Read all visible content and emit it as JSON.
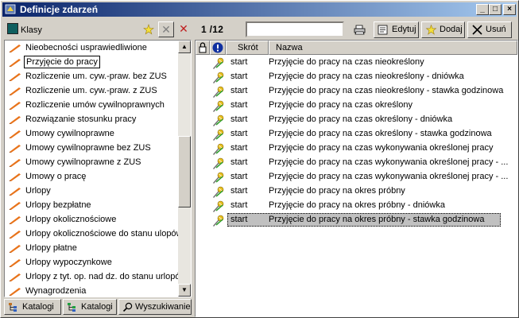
{
  "window": {
    "title": "Definicje zdarzeń"
  },
  "left_panel": {
    "header_label": "Klasy",
    "items": [
      {
        "label": "Nieobecności usprawiedliwione"
      },
      {
        "label": "Przyjęcie do pracy",
        "selected": true
      },
      {
        "label": "Rozliczenie um. cyw.-praw. bez ZUS"
      },
      {
        "label": "Rozliczenie um. cyw.-praw. z ZUS"
      },
      {
        "label": "Rozliczenie umów cywilnoprawnych"
      },
      {
        "label": "Rozwiązanie stosunku pracy"
      },
      {
        "label": "Umowy cywilnoprawne"
      },
      {
        "label": "Umowy cywilnoprawne bez ZUS"
      },
      {
        "label": "Umowy cywilnoprawne z ZUS"
      },
      {
        "label": "Umowy o pracę"
      },
      {
        "label": "Urlopy"
      },
      {
        "label": "Urlopy bezpłatne"
      },
      {
        "label": "Urlopy okolicznościowe"
      },
      {
        "label": "Urlopy okolicznościowe do stanu ulopów"
      },
      {
        "label": "Urlopy płatne"
      },
      {
        "label": "Urlopy wypoczynkowe"
      },
      {
        "label": "Urlopy z tyt. op. nad dz. do stanu urlopów"
      },
      {
        "label": "Wynagrodzenia"
      }
    ],
    "bottom_tabs": [
      "Katalogi",
      "Katalogi",
      "Wyszukiwanie"
    ]
  },
  "right_panel": {
    "counter": "1 /12",
    "search_value": "",
    "buttons": {
      "edit": "Edytuj",
      "add": "Dodaj",
      "delete": "Usuń"
    },
    "columns": {
      "skrot": "Skrót",
      "nazwa": "Nazwa"
    },
    "rows": [
      {
        "skrot": "start",
        "nazwa": "Przyjęcie do pracy na czas nieokreślony"
      },
      {
        "skrot": "start",
        "nazwa": "Przyjęcie do pracy na czas nieokreślony - dniówka"
      },
      {
        "skrot": "start",
        "nazwa": "Przyjęcie do pracy na czas nieokreślony - stawka godzinowa"
      },
      {
        "skrot": "start",
        "nazwa": "Przyjęcie do pracy na czas określony"
      },
      {
        "skrot": "start",
        "nazwa": "Przyjęcie do pracy na czas określony - dniówka"
      },
      {
        "skrot": "start",
        "nazwa": "Przyjęcie do pracy na czas określony - stawka godzinowa"
      },
      {
        "skrot": "start",
        "nazwa": "Przyjęcie do pracy na czas wykonywania określonej pracy"
      },
      {
        "skrot": "start",
        "nazwa": "Przyjęcie do pracy na czas wykonywania określonej pracy - ..."
      },
      {
        "skrot": "start",
        "nazwa": "Przyjęcie do pracy na czas wykonywania określonej pracy - ..."
      },
      {
        "skrot": "start",
        "nazwa": "Przyjęcie do pracy na okres próbny"
      },
      {
        "skrot": "start",
        "nazwa": "Przyjęcie do pracy na okres próbny - dniówka"
      },
      {
        "skrot": "start",
        "nazwa": "Przyjęcie do pracy na okres próbny - stawka godzinowa",
        "selected": true
      }
    ]
  },
  "colors": {
    "title_start": "#0a246a",
    "title_end": "#a6caf0",
    "face": "#d4d0c8",
    "pencil": "#e8731a"
  }
}
